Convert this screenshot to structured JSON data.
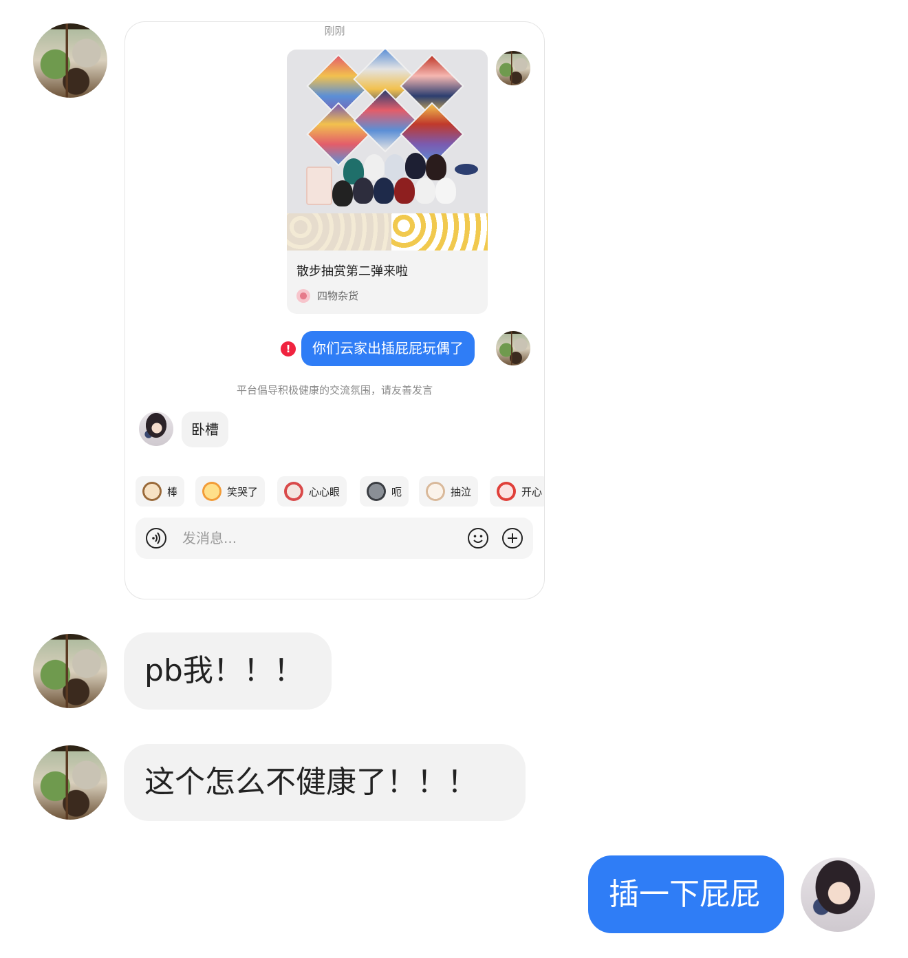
{
  "chat": {
    "screenshot": {
      "timestamp": "刚刚",
      "product": {
        "title": "散步抽赏第二弹来啦",
        "shop": "四物杂货"
      },
      "sent_message": "你们云家出插屁屁玩偶了",
      "error_mark": "!",
      "notice": "平台倡导积极健康的交流氛围，请友善发言",
      "reply": "卧槽",
      "emoji_chips": [
        "棒",
        "笑哭了",
        "心心眼",
        "呃",
        "抽泣",
        "开心"
      ],
      "input": {
        "placeholder": "发消息..."
      }
    },
    "messages": [
      {
        "text": "pb我！！！"
      },
      {
        "text": "这个怎么不健康了！！！"
      }
    ],
    "my_message": "插一下屁屁"
  },
  "colors": {
    "accent_blue": "#2f7df6",
    "bubble_gray": "#f2f2f2",
    "error_red": "#f0233f"
  },
  "icons": [
    "voice-icon",
    "emoji-icon",
    "plus-icon",
    "error-icon"
  ]
}
